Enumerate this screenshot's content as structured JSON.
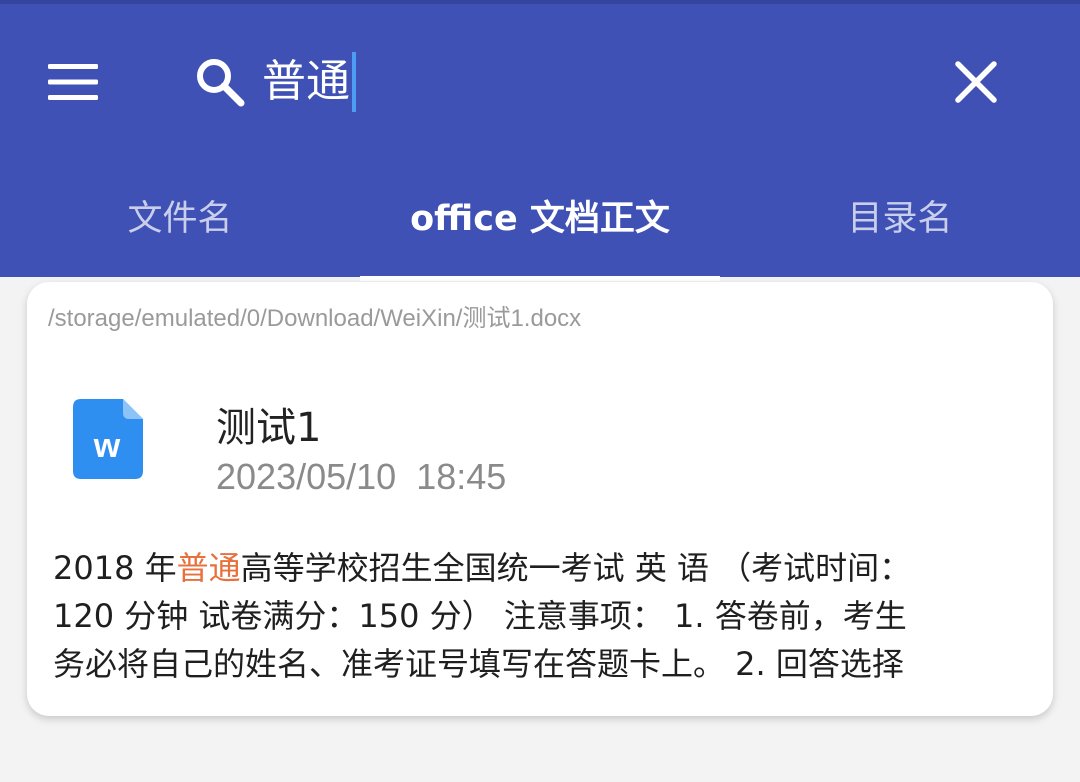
{
  "search": {
    "query": "普通"
  },
  "tabs": [
    {
      "label": "文件名",
      "active": false
    },
    {
      "label": "office 文档正文",
      "active": true
    },
    {
      "label": "目录名",
      "active": false
    }
  ],
  "result": {
    "path": "/storage/emulated/0/Download/WeiXin/测试1.docx",
    "file_icon_letter": "w",
    "name": "测试1",
    "date": "2023/05/10",
    "time": "18:45",
    "preview": {
      "line1_prefix": "2018 年",
      "line1_highlight": "普通",
      "line1_suffix": "高等学校招生全国统一考试 英 语 （考试时间：",
      "line2": "120 分钟 试卷满分：150 分） 注意事项： 1. 答卷前，考生",
      "line3": "务必将自己的姓名、准考证号填写在答题卡上。 2. 回答选择"
    }
  },
  "colors": {
    "appbar": "#3f51b5",
    "highlight": "#e8703d",
    "doc_icon": "#2f8ff0",
    "caret": "#4d9df5"
  },
  "icons": {
    "menu": "menu-icon",
    "search": "search-icon",
    "close": "close-icon",
    "file": "word-document-icon"
  }
}
